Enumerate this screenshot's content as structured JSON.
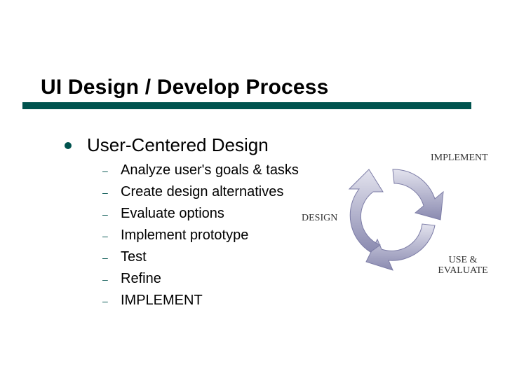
{
  "title": "UI Design / Develop Process",
  "section": "User-Centered Design",
  "steps": [
    "Analyze user's goals & tasks",
    "Create design alternatives",
    "Evaluate options",
    "Implement prototype",
    "Test",
    "Refine",
    "IMPLEMENT"
  ],
  "cycle": {
    "labels": {
      "implement": "IMPLEMENT",
      "design": "DESIGN",
      "use_evaluate": "USE & EVALUATE"
    }
  }
}
